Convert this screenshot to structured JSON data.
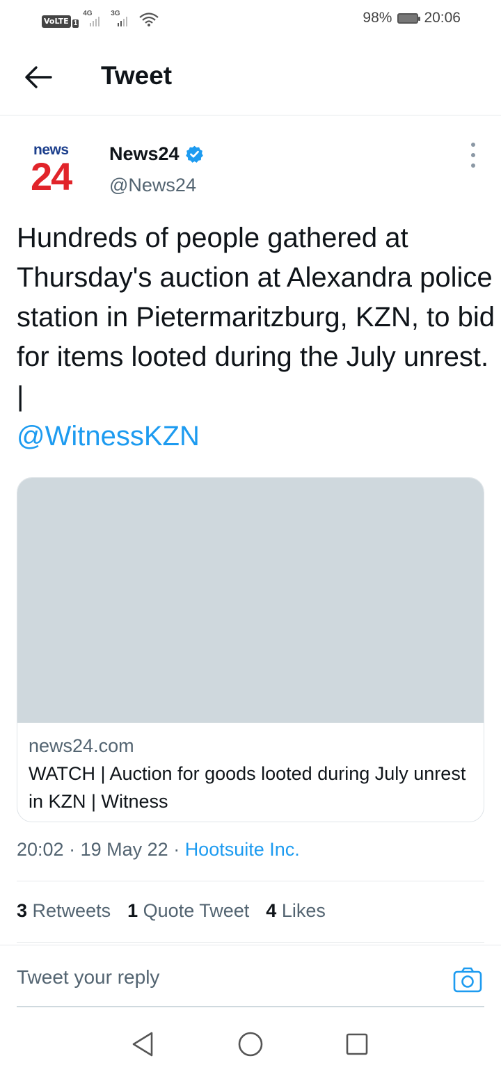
{
  "status_bar": {
    "volte": "VoLTE",
    "sim": "1",
    "net1": "4G",
    "net2": "3G",
    "battery_pct": "98%",
    "time": "20:06",
    "icons": [
      "signal-icon",
      "wifi-icon",
      "battery-icon"
    ]
  },
  "header": {
    "title": "Tweet",
    "back_icon": "arrow-left-icon"
  },
  "tweet": {
    "avatar": {
      "top": "news",
      "bottom": "24"
    },
    "author_name": "News24",
    "author_handle": "@News24",
    "verified": true,
    "text": "Hundreds of people gathered at Thursday's auction at Alexandra police station in Pietermaritzburg, KZN, to bid for items looted during the July unrest. |",
    "mention": "@WitnessKZN",
    "card": {
      "domain": "news24.com",
      "title": "WATCH | Auction for goods looted during July unrest in KZN | Witness"
    },
    "time": "20:02",
    "date": "19 May 22",
    "source": "Hootsuite Inc.",
    "stats": [
      {
        "count": "3",
        "label": "Retweets"
      },
      {
        "count": "1",
        "label": "Quote Tweet"
      },
      {
        "count": "4",
        "label": "Likes"
      }
    ]
  },
  "reply": {
    "placeholder": "Tweet your reply"
  },
  "colors": {
    "accent": "#1d9bf0",
    "text": "#0f1419",
    "muted": "#536471",
    "card_image": "#cfd8dd",
    "logo_blue": "#1c3f8c",
    "logo_red": "#e1242a"
  }
}
